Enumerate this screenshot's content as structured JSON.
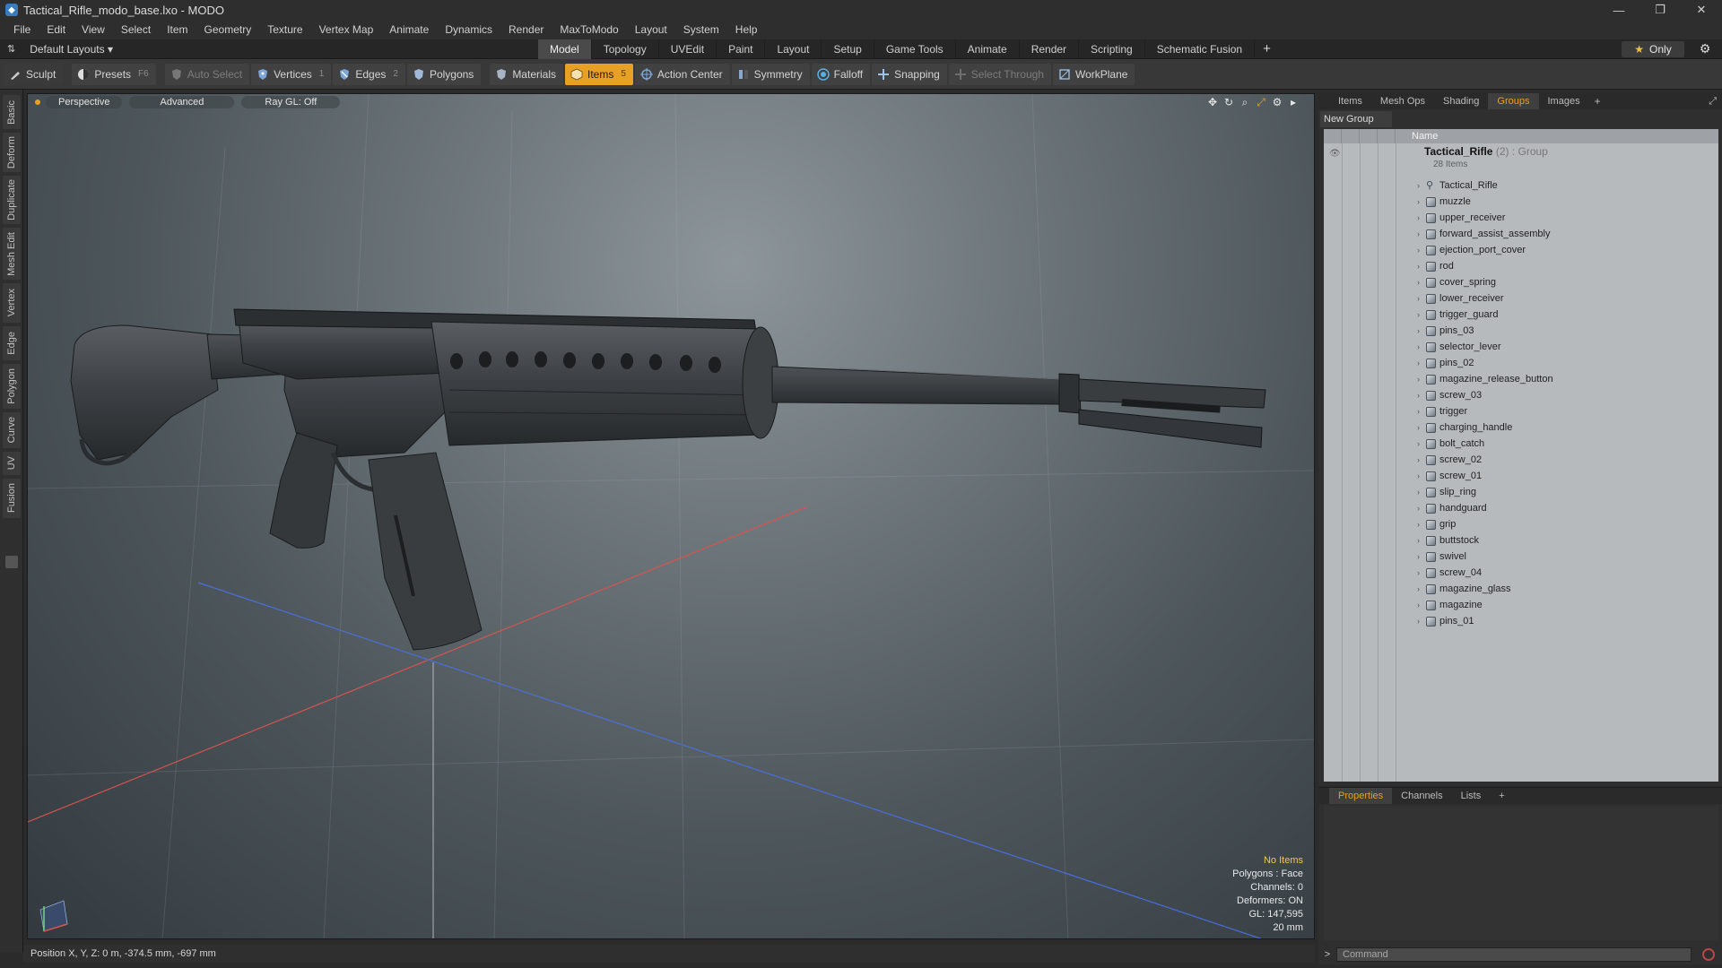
{
  "window": {
    "title": "Tactical_Rifle_modo_base.lxo - MODO",
    "controls": [
      "—",
      "❐",
      "✕"
    ]
  },
  "menu": [
    "File",
    "Edit",
    "View",
    "Select",
    "Item",
    "Geometry",
    "Texture",
    "Vertex Map",
    "Animate",
    "Dynamics",
    "Render",
    "MaxToModo",
    "Layout",
    "System",
    "Help"
  ],
  "layout": {
    "selector_label": "Default Layouts ▾",
    "tabs": [
      "Model",
      "Topology",
      "UVEdit",
      "Paint",
      "Layout",
      "Setup",
      "Game Tools",
      "Animate",
      "Render",
      "Scripting",
      "Schematic Fusion"
    ],
    "active_tab": "Model",
    "add": "+",
    "only_label": "Only"
  },
  "toolbar": {
    "sculpt": "Sculpt",
    "presets": "Presets",
    "presets_key": "F6",
    "auto_select": "Auto Select",
    "vertices": "Vertices",
    "vertices_key": "1",
    "edges": "Edges",
    "edges_key": "2",
    "polygons": "Polygons",
    "materials": "Materials",
    "items": "Items",
    "items_key": "5",
    "action_center": "Action Center",
    "symmetry": "Symmetry",
    "falloff": "Falloff",
    "snapping": "Snapping",
    "select_through": "Select Through",
    "workplane": "WorkPlane"
  },
  "left_tabs": [
    "Basic",
    "Deform",
    "Duplicate",
    "Mesh Edit",
    "Vertex",
    "Edge",
    "Polygon",
    "Curve",
    "UV",
    "Fusion"
  ],
  "viewport": {
    "view_mode": "Perspective",
    "shading": "Advanced",
    "raygl": "Ray GL: Off",
    "info": {
      "selection": "No Items",
      "polygons": "Polygons : Face",
      "channels": "Channels: 0",
      "deformers": "Deformers: ON",
      "gl": "GL: 147,595",
      "unit": "20 mm"
    }
  },
  "status": {
    "position": "Position X, Y, Z:  0 m, -374.5 mm, -697 mm"
  },
  "right_panel": {
    "tabs": [
      "Items",
      "Mesh Ops",
      "Shading",
      "Groups",
      "Images"
    ],
    "active_tab": "Groups",
    "add": "+",
    "new_group": "New Group",
    "name_header": "Name",
    "group_name": "Tactical_Rifle",
    "group_suffix": "(2) : Group",
    "group_count": "28 Items",
    "locator": "Tactical_Rifle",
    "items": [
      "muzzle",
      "upper_receiver",
      "forward_assist_assembly",
      "ejection_port_cover",
      "rod",
      "cover_spring",
      "lower_receiver",
      "trigger_guard",
      "pins_03",
      "selector_lever",
      "pins_02",
      "magazine_release_button",
      "screw_03",
      "trigger",
      "charging_handle",
      "bolt_catch",
      "screw_02",
      "screw_01",
      "slip_ring",
      "handguard",
      "grip",
      "buttstock",
      "swivel",
      "screw_04",
      "magazine_glass",
      "magazine",
      "pins_01"
    ]
  },
  "properties_panel": {
    "tabs": [
      "Properties",
      "Channels",
      "Lists"
    ],
    "active_tab": "Properties",
    "add": "+"
  },
  "command": {
    "placeholder": "Command",
    "prompt": ">"
  }
}
